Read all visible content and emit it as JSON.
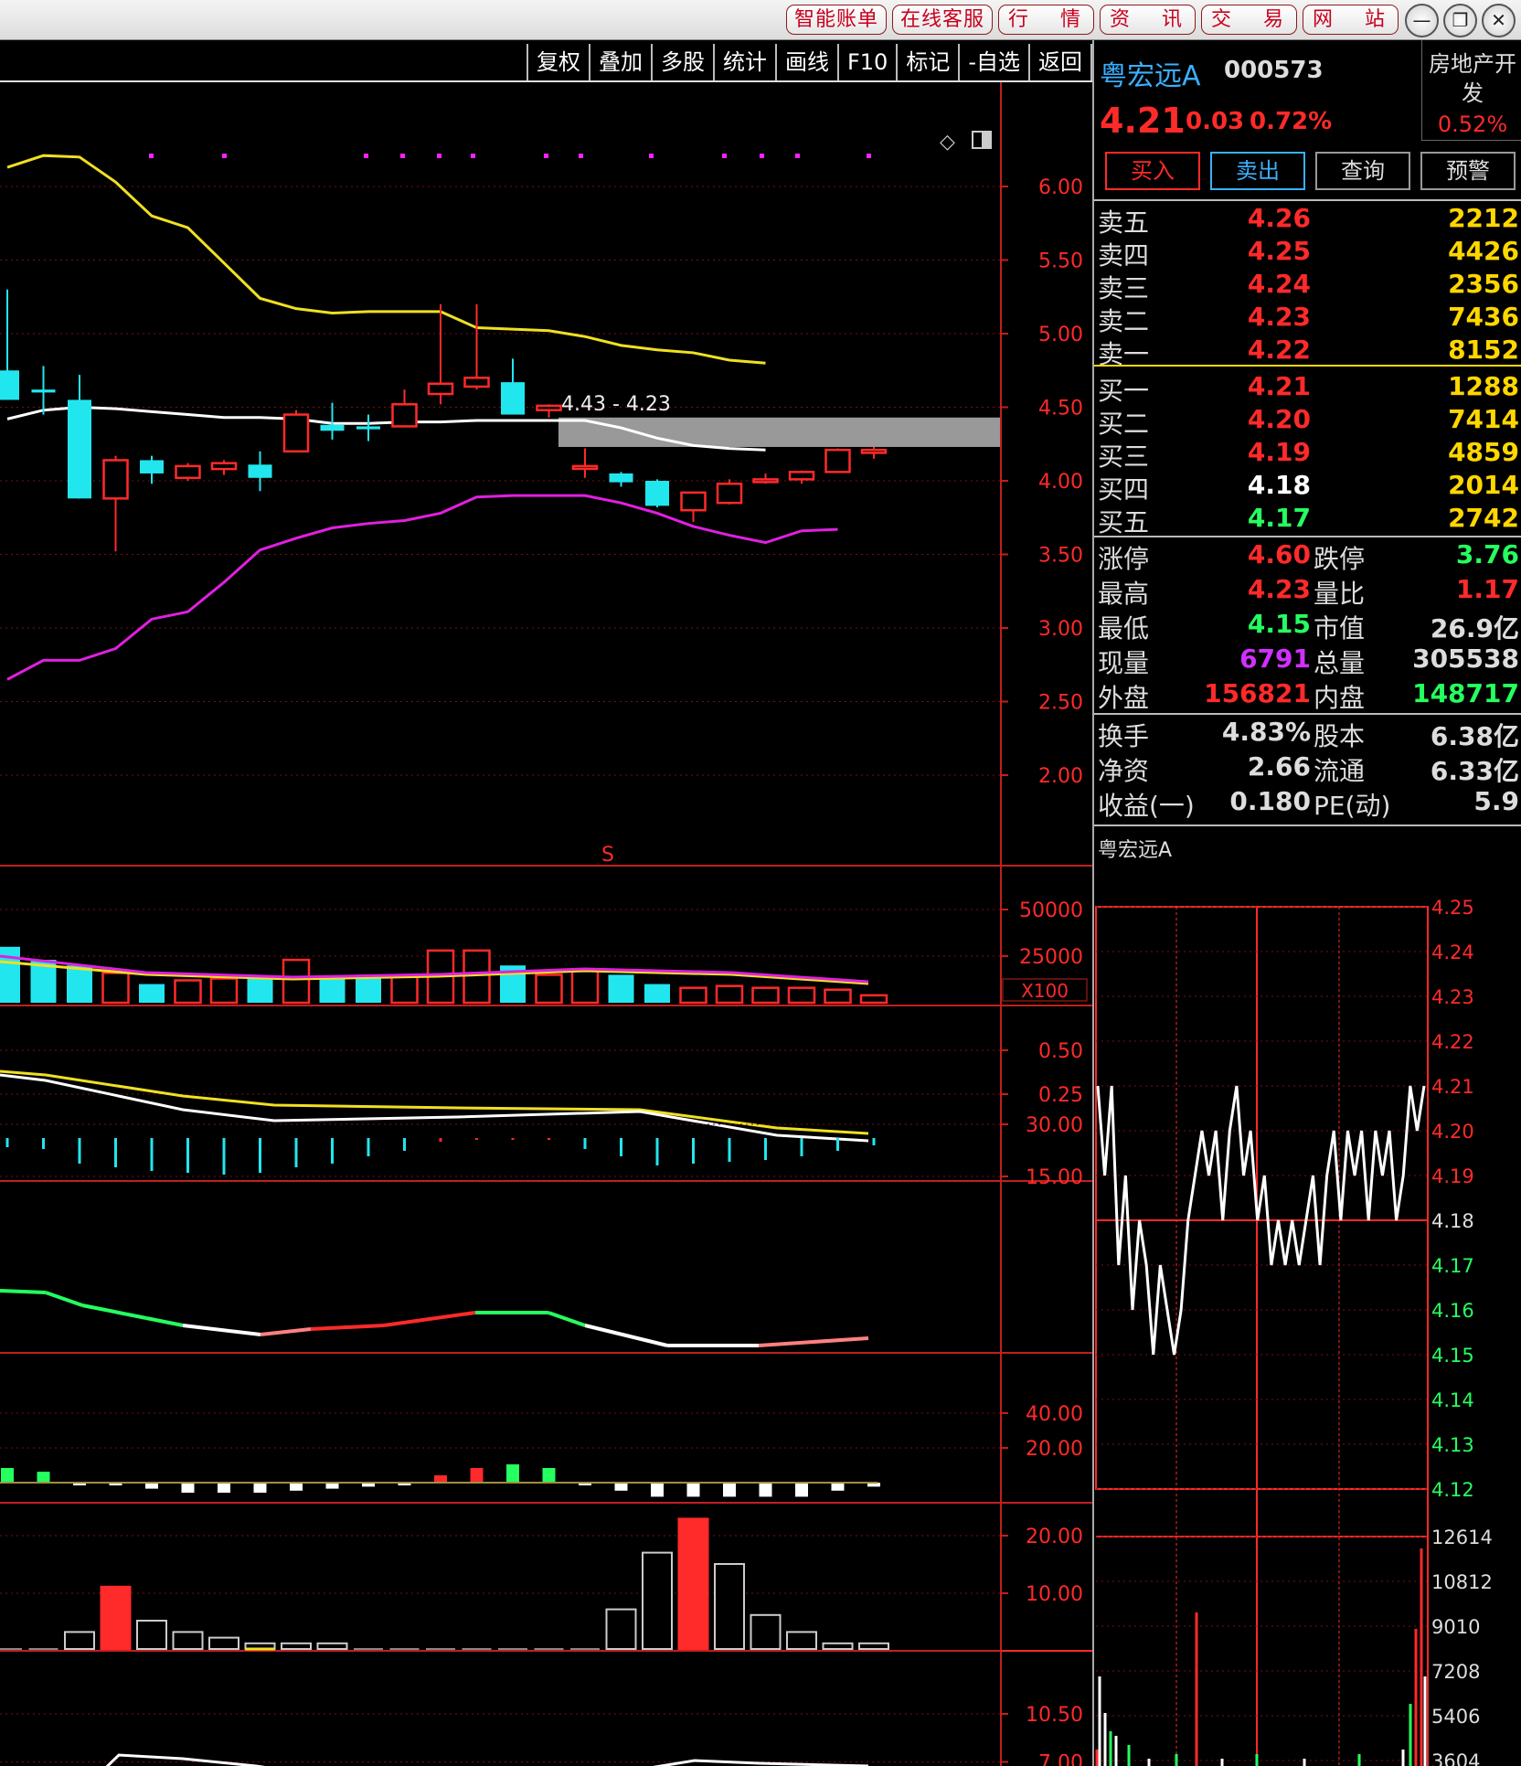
{
  "titlebar": {
    "buttons": [
      "智能账单",
      "在线客服",
      "行 情",
      "资 讯",
      "交 易",
      "网 站"
    ],
    "window_controls": [
      "—",
      "❐",
      "✕"
    ]
  },
  "toolbar": [
    "复权",
    "叠加",
    "多股",
    "统计",
    "画线",
    "F10",
    "标记",
    "-自选",
    "返回"
  ],
  "chart": {
    "price_axis": [
      "6.00",
      "5.50",
      "5.00",
      "4.50",
      "4.00",
      "3.50",
      "3.00",
      "2.50",
      "2.00"
    ],
    "range_label": "4.43 - 4.23",
    "marker": "S",
    "volume_axis": [
      "50000",
      "25000"
    ],
    "volume_unit": "X100",
    "macd_axis": [
      "0.50",
      "0.25"
    ],
    "ind3_axis": [
      "30.00",
      "15.00"
    ],
    "ind4_axis": [
      "40.00",
      "20.00"
    ],
    "ind5_axis": [
      "20.00",
      "10.00"
    ],
    "ind6_axis": [
      "10.50",
      "7.00"
    ]
  },
  "chart_data": {
    "type": "candlestick",
    "candles": [
      {
        "o": 4.75,
        "h": 5.3,
        "l": 4.55,
        "c": 4.55
      },
      {
        "o": 4.62,
        "h": 4.78,
        "l": 4.45,
        "c": 4.6
      },
      {
        "o": 4.55,
        "h": 4.72,
        "l": 3.88,
        "c": 3.88
      },
      {
        "o": 3.88,
        "h": 4.17,
        "l": 3.52,
        "c": 4.14
      },
      {
        "o": 4.14,
        "h": 4.17,
        "l": 3.98,
        "c": 4.05
      },
      {
        "o": 4.02,
        "h": 4.12,
        "l": 4.0,
        "c": 4.1
      },
      {
        "o": 4.08,
        "h": 4.14,
        "l": 4.04,
        "c": 4.12
      },
      {
        "o": 4.11,
        "h": 4.2,
        "l": 3.93,
        "c": 4.02
      },
      {
        "o": 4.2,
        "h": 4.48,
        "l": 4.2,
        "c": 4.45
      },
      {
        "o": 4.38,
        "h": 4.53,
        "l": 4.28,
        "c": 4.34
      },
      {
        "o": 4.37,
        "h": 4.45,
        "l": 4.27,
        "c": 4.35
      },
      {
        "o": 4.37,
        "h": 4.62,
        "l": 4.37,
        "c": 4.52
      },
      {
        "o": 4.59,
        "h": 5.2,
        "l": 4.52,
        "c": 4.66
      },
      {
        "o": 4.64,
        "h": 5.2,
        "l": 4.62,
        "c": 4.7
      },
      {
        "o": 4.67,
        "h": 4.83,
        "l": 4.45,
        "c": 4.45
      },
      {
        "o": 4.48,
        "h": 4.52,
        "l": 4.43,
        "c": 4.51
      },
      {
        "o": 4.1,
        "h": 4.22,
        "l": 4.02,
        "c": 4.1
      },
      {
        "o": 4.05,
        "h": 4.06,
        "l": 3.96,
        "c": 3.99
      },
      {
        "o": 4.0,
        "h": 4.01,
        "l": 3.82,
        "c": 3.83
      },
      {
        "o": 3.8,
        "h": 3.92,
        "l": 3.72,
        "c": 3.92
      },
      {
        "o": 3.85,
        "h": 4.01,
        "l": 3.84,
        "c": 3.98
      },
      {
        "o": 4.0,
        "h": 4.05,
        "l": 3.98,
        "c": 4.01
      },
      {
        "o": 4.01,
        "h": 4.07,
        "l": 3.98,
        "c": 4.06
      },
      {
        "o": 4.06,
        "h": 4.22,
        "l": 4.06,
        "c": 4.21
      },
      {
        "o": 4.19,
        "h": 4.23,
        "l": 4.15,
        "c": 4.21
      }
    ],
    "boll_upper": [
      6.13,
      6.21,
      6.2,
      6.03,
      5.8,
      5.72,
      5.48,
      5.24,
      5.17,
      5.14,
      5.15,
      5.15,
      5.15,
      5.04,
      5.03,
      5.02,
      4.98,
      4.92,
      4.89,
      4.87,
      4.82,
      4.8
    ],
    "boll_mid": [
      4.42,
      4.48,
      4.5,
      4.49,
      4.47,
      4.45,
      4.43,
      4.43,
      4.42,
      4.39,
      4.39,
      4.4,
      4.4,
      4.41,
      4.41,
      4.41,
      4.41,
      4.36,
      4.29,
      4.24,
      4.22,
      4.21
    ],
    "boll_lower": [
      2.65,
      2.78,
      2.78,
      2.86,
      3.06,
      3.11,
      3.31,
      3.53,
      3.61,
      3.68,
      3.71,
      3.73,
      3.78,
      3.89,
      3.9,
      3.9,
      3.9,
      3.85,
      3.78,
      3.69,
      3.63,
      3.58,
      3.66,
      3.67
    ],
    "volume": [
      30000,
      23000,
      20000,
      16000,
      10000,
      12000,
      13000,
      13000,
      23000,
      14000,
      15000,
      14000,
      28000,
      28000,
      20000,
      15000,
      18000,
      15000,
      10000,
      8000,
      9000,
      8000,
      8000,
      7000,
      4000
    ]
  },
  "panel": {
    "name": "粤宏远A",
    "code": "000573",
    "sector": "房地产开发",
    "sector_pct": "0.52%",
    "price": "4.21",
    "change": "0.03",
    "change_pct": "0.72%",
    "actions": [
      "买入",
      "卖出",
      "查询",
      "预警"
    ],
    "sell": [
      {
        "label": "卖五",
        "price": "4.26",
        "vol": "2212"
      },
      {
        "label": "卖四",
        "price": "4.25",
        "vol": "4426"
      },
      {
        "label": "卖三",
        "price": "4.24",
        "vol": "2356"
      },
      {
        "label": "卖二",
        "price": "4.23",
        "vol": "7436"
      },
      {
        "label": "卖一",
        "price": "4.22",
        "vol": "8152"
      }
    ],
    "buy": [
      {
        "label": "买一",
        "price": "4.21",
        "vol": "1288"
      },
      {
        "label": "买二",
        "price": "4.20",
        "vol": "7414"
      },
      {
        "label": "买三",
        "price": "4.19",
        "vol": "4859"
      },
      {
        "label": "买四",
        "price": "4.18",
        "vol": "2014"
      },
      {
        "label": "买五",
        "price": "4.17",
        "vol": "2742"
      }
    ],
    "stats1": [
      {
        "l1": "涨停",
        "v1": "4.60",
        "l2": "跌停",
        "v2": "3.76"
      },
      {
        "l1": "最高",
        "v1": "4.23",
        "l2": "量比",
        "v2": "1.17"
      },
      {
        "l1": "最低",
        "v1": "4.15",
        "l2": "市值",
        "v2": "26.9亿"
      },
      {
        "l1": "现量",
        "v1": "6791",
        "l2": "总量",
        "v2": "305538"
      },
      {
        "l1": "外盘",
        "v1": "156821",
        "l2": "内盘",
        "v2": "148717"
      }
    ],
    "stats2": [
      {
        "l1": "换手",
        "v1": "4.83%",
        "l2": "股本",
        "v2": "6.38亿"
      },
      {
        "l1": "净资",
        "v1": "2.66",
        "l2": "流通",
        "v2": "6.33亿"
      },
      {
        "l1": "收益(一)",
        "v1": "0.180",
        "l2": "PE(动)",
        "v2": "5.9"
      }
    ],
    "mini_title": "粤宏远A",
    "mini_price_axis": [
      "4.25",
      "4.24",
      "4.23",
      "4.22",
      "4.21",
      "4.20",
      "4.19",
      "4.18",
      "4.17",
      "4.16",
      "4.15",
      "4.14",
      "4.13",
      "4.12"
    ],
    "mini_vol_axis": [
      "12614",
      "10812",
      "9010",
      "7208",
      "5406",
      "3604"
    ]
  }
}
